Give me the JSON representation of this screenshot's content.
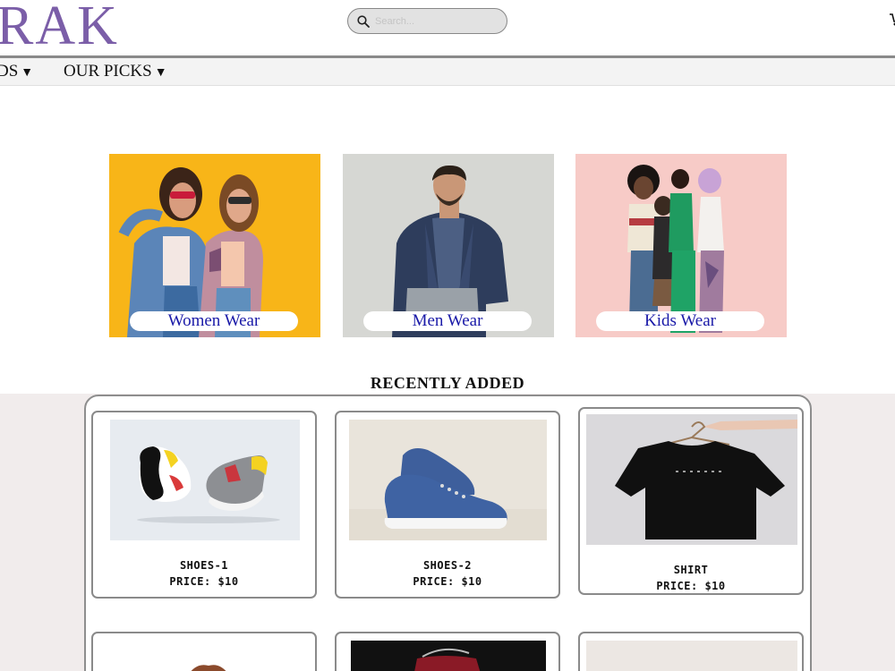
{
  "header": {
    "logo_text": "RAK",
    "search_placeholder": "Search...",
    "search_icon": "search-icon",
    "cart_icon": "cart-icon"
  },
  "nav": {
    "items": [
      {
        "label": "DS",
        "icon": "caret-down-icon"
      },
      {
        "label": "OUR PICKS",
        "icon": "caret-down-icon"
      }
    ]
  },
  "categories": [
    {
      "label": "Women Wear"
    },
    {
      "label": "Men Wear"
    },
    {
      "label": "Kids Wear"
    }
  ],
  "recent": {
    "title": "RECENTLY ADDED",
    "products": [
      {
        "name": "SHOES-1",
        "price": "PRICE: $10"
      },
      {
        "name": "SHOES-2",
        "price": "PRICE: $10"
      },
      {
        "name": "SHIRT",
        "price": "PRICE: $10"
      }
    ]
  },
  "colors": {
    "logo": "#7b5ea8",
    "category_label": "#1a1aa8",
    "recent_background": "#f1ecec"
  }
}
